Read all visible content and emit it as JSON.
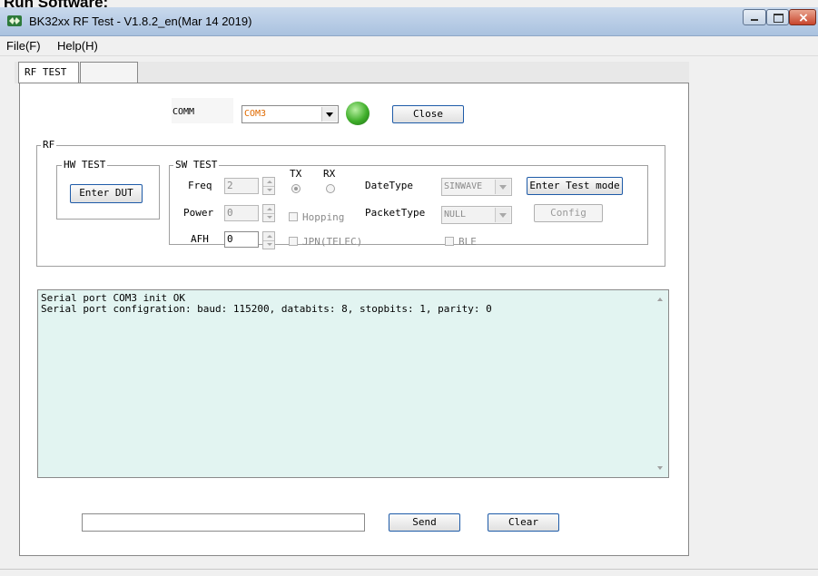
{
  "doc_caption": "Run Software:",
  "window": {
    "title": "BK32xx RF Test - V1.8.2_en(Mar 14 2019)",
    "icons": [
      "app-icon",
      "minimize-icon",
      "maximize-icon",
      "close-icon"
    ]
  },
  "menu": {
    "file": "File(F)",
    "help": "Help(H)"
  },
  "tabs": [
    {
      "label": "RF TEST"
    },
    {
      "label": ""
    }
  ],
  "comm": {
    "label": "COMM",
    "port": "COM3",
    "status_color": "#3fae2a",
    "close_label": "Close"
  },
  "rf": {
    "label": "RF",
    "hw_test": {
      "label": "HW TEST",
      "enter_dut": "Enter DUT"
    },
    "sw_test": {
      "label": "SW TEST",
      "freq_label": "Freq",
      "freq_value": "2",
      "power_label": "Power",
      "power_value": "0",
      "afh_label": "AFH",
      "afh_value": "0",
      "tx_label": "TX",
      "rx_label": "RX",
      "hopping_label": "Hopping",
      "jpn_label": "JPN(TELEC)",
      "datetype_label": "DateType",
      "datetype_value": "SINWAVE",
      "packettype_label": "PacketType",
      "packettype_value": "NULL",
      "ble_label": "BLE",
      "enter_test_mode": "Enter Test mode",
      "config": "Config"
    }
  },
  "log": {
    "lines": [
      "Serial port COM3 init OK",
      "Serial port configration: baud: 115200, databits: 8, stopbits: 1, parity: 0"
    ]
  },
  "bottom": {
    "send_input": "",
    "send_label": "Send",
    "clear_label": "Clear"
  }
}
